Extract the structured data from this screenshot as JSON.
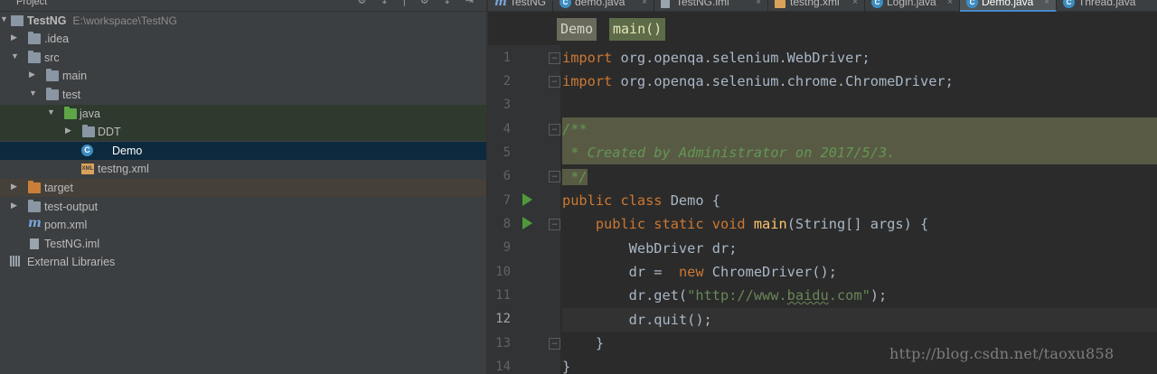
{
  "panel": {
    "title": "Project",
    "header_icons": "⚙ ↕ | ⚙ ↓ ⇥"
  },
  "tree": [
    {
      "label": "TestNG",
      "path": "E:\\workspace\\TestNG",
      "icon": "project-icon",
      "arrow": "▼"
    },
    {
      "label": ".idea",
      "icon": "folder-icon",
      "arrow": "▶"
    },
    {
      "label": "src",
      "icon": "folder-icon",
      "arrow": "▼"
    },
    {
      "label": "main",
      "icon": "folder-icon",
      "arrow": "▶"
    },
    {
      "label": "test",
      "icon": "folder-icon",
      "arrow": "▼"
    },
    {
      "label": "java",
      "icon": "green-folder-icon",
      "arrow": "▼"
    },
    {
      "label": "DDT",
      "icon": "package-folder-icon",
      "arrow": "▶"
    },
    {
      "label": "Demo",
      "icon": "java-class-icon"
    },
    {
      "label": "testng.xml",
      "icon": "xml-file-icon"
    },
    {
      "label": "target",
      "icon": "orange-folder-icon",
      "arrow": "▶"
    },
    {
      "label": "test-output",
      "icon": "folder-icon",
      "arrow": "▶"
    },
    {
      "label": "pom.xml",
      "icon": "maven-icon"
    },
    {
      "label": "TestNG.iml",
      "icon": "iml-file-icon"
    },
    {
      "label": "External Libraries",
      "icon": "libraries-icon"
    }
  ],
  "tabs": [
    {
      "label": "TestNG",
      "icon": "m"
    },
    {
      "label": "demo.java",
      "icon": "c"
    },
    {
      "label": "TestNG.iml",
      "icon": "file"
    },
    {
      "label": "testng.xml",
      "icon": "xml"
    },
    {
      "label": "Login.java",
      "icon": "c"
    },
    {
      "label": "Demo.java",
      "icon": "c",
      "active": true
    },
    {
      "label": "Thread.java",
      "icon": "c"
    }
  ],
  "tab_close": "×",
  "breadcrumb": [
    "Demo",
    "main()"
  ],
  "gutter": {
    "line_numbers": [
      "1",
      "2",
      "3",
      "4",
      "5",
      "6",
      "7",
      "8",
      "9",
      "10",
      "11",
      "12",
      "13",
      "14"
    ],
    "current_line": 12
  },
  "code": {
    "l1": [
      "import",
      " org.openqa.selenium.WebDriver;"
    ],
    "l2": [
      "import",
      " org.openqa.selenium.chrome.ChromeDriver;"
    ],
    "l4": "/**",
    "l5": " * Created by Administrator on 2017/5/3.",
    "l6": " */",
    "l7": [
      "public class",
      " Demo {"
    ],
    "l8": [
      "    ",
      "public static void",
      " ",
      "main",
      "(String[] args) {"
    ],
    "l9": "        WebDriver dr;",
    "l10": [
      "        dr =  ",
      "new",
      " ChromeDriver();"
    ],
    "l11": [
      "        dr.get(",
      "\"http://www.",
      "baidu",
      ".com\"",
      ");"
    ],
    "l12": "        dr.quit();",
    "l13": "    }",
    "l14": "}"
  },
  "watermark": "http://blog.csdn.net/taoxu858",
  "colors": {
    "keyword": "#cc7832",
    "string": "#6a8759",
    "method": "#ffc66d",
    "doc_comment": "#629755",
    "selection": "#0d293e"
  }
}
